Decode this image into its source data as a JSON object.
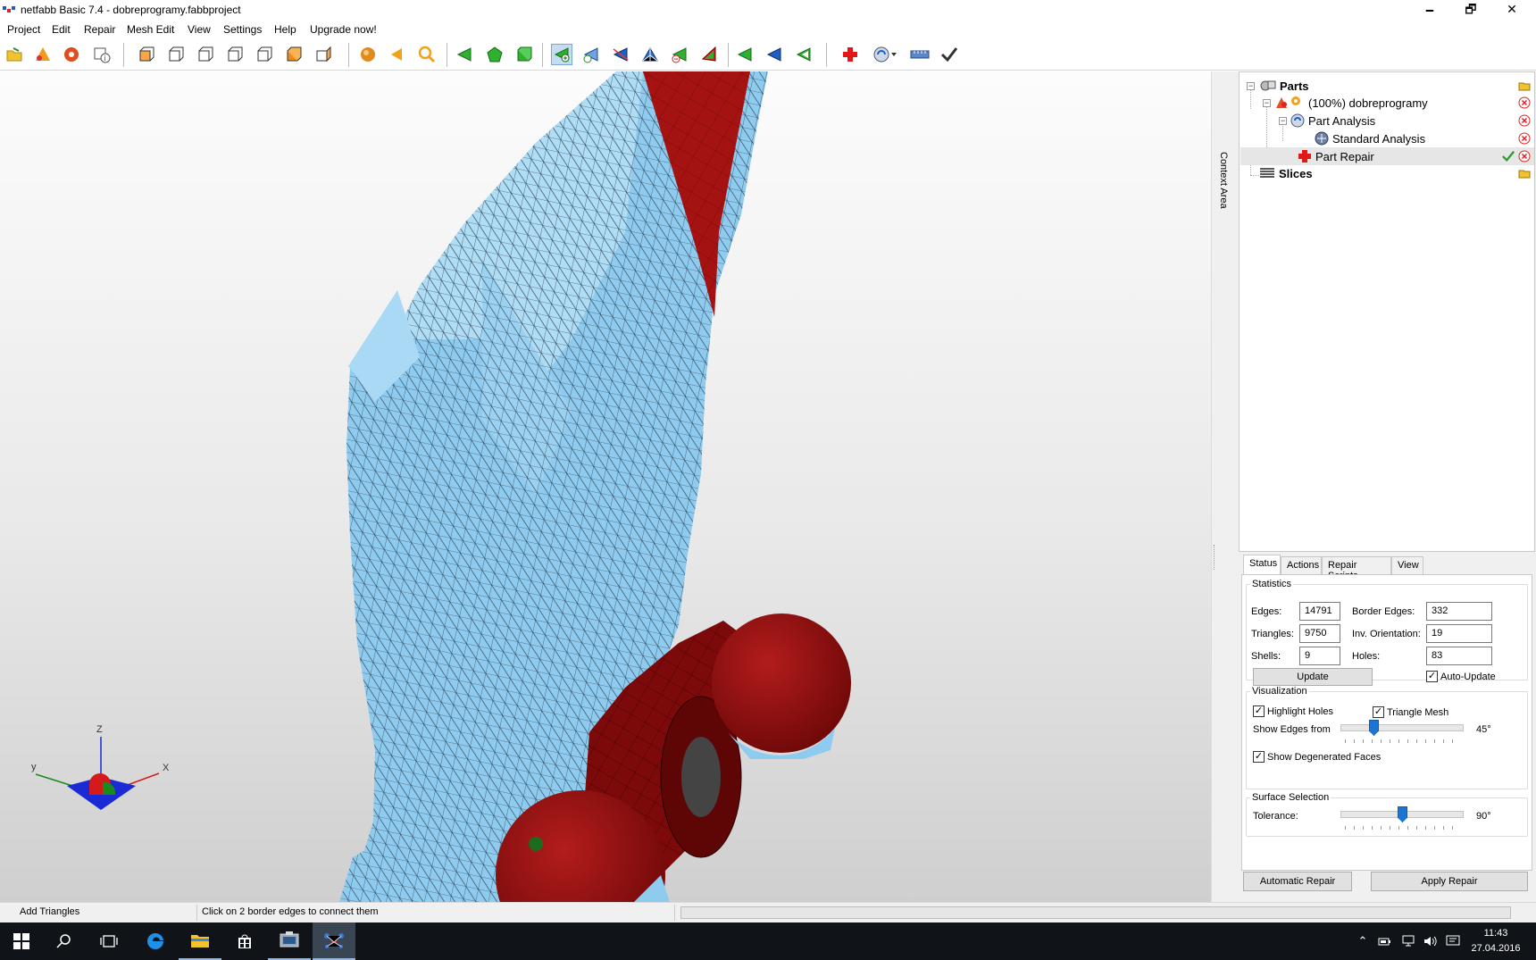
{
  "window": {
    "title": "netfabb Basic 7.4 - dobreprogramy.fabbproject",
    "minimize_glyph": "🗕",
    "restore_glyph": "🗗",
    "close_glyph": "✕"
  },
  "menu": [
    "Project",
    "Edit",
    "Repair",
    "Mesh Edit",
    "View",
    "Settings",
    "Help",
    "Upgrade now!"
  ],
  "toolbar": {
    "icons": [
      "open-project",
      "add-part",
      "remove-part",
      "part-info",
      "view-front",
      "view-back",
      "view-left",
      "view-right",
      "view-top",
      "view-bottom",
      "view-iso",
      "shaded-sphere",
      "select-arrow",
      "zoom-magnifier",
      "select-triangles",
      "select-surface",
      "select-shell",
      "add-triangles",
      "add-point",
      "split-triangles",
      "move-point",
      "remove-triangles",
      "remove-degenerated",
      "extend-selection",
      "invert-selection",
      "shrink-selection",
      "add-repair",
      "orientation-tool",
      "measure-ruler",
      "apply-check"
    ],
    "active": "add-triangles"
  },
  "context_area_label": "Context Area",
  "tree": {
    "items": [
      {
        "label": "Parts"
      },
      {
        "label": "(100%) dobreprogramy"
      },
      {
        "label": "Part Analysis"
      },
      {
        "label": "Standard Analysis"
      },
      {
        "label": "Part Repair"
      },
      {
        "label": "Slices"
      }
    ]
  },
  "tabs": [
    "Status",
    "Actions",
    "Repair Scripts",
    "View"
  ],
  "status": {
    "statistics_title": "Statistics",
    "edges_label": "Edges:",
    "edges": "14791",
    "triangles_label": "Triangles:",
    "triangles": "9750",
    "shells_label": "Shells:",
    "shells": "9",
    "border_edges_label": "Border Edges:",
    "border_edges": "332",
    "inv_orientation_label": "Inv. Orientation:",
    "inv_orientation": "19",
    "holes_label": "Holes:",
    "holes": "83",
    "update_button": "Update",
    "auto_update_label": "Auto-Update",
    "auto_update_checked": true
  },
  "visualization": {
    "title": "Visualization",
    "highlight_holes_label": "Highlight Holes",
    "highlight_holes_checked": true,
    "triangle_mesh_label": "Triangle Mesh",
    "triangle_mesh_checked": true,
    "show_edges_label": "Show Edges from",
    "show_edges_value": "45°",
    "show_edges_fraction": 0.25,
    "degenerated_label": "Show Degenerated Faces",
    "degenerated_checked": true
  },
  "surface_selection": {
    "title": "Surface Selection",
    "tolerance_label": "Tolerance:",
    "tolerance_value": "90°",
    "tolerance_fraction": 0.5
  },
  "buttons": {
    "automatic_repair": "Automatic Repair",
    "apply_repair": "Apply Repair"
  },
  "statusbar": {
    "tool": "Add Triangles",
    "hint": "Click on 2 border edges to connect them"
  },
  "axes": {
    "z": "Z",
    "y": "y",
    "x": "X"
  },
  "taskbar": {
    "icons": [
      "windows-start",
      "search",
      "task-view",
      "edge-browser",
      "file-explorer",
      "store",
      "network-app",
      "netfabb"
    ],
    "active": "netfabb",
    "clock_time": "11:43",
    "clock_date": "27.04.2016"
  },
  "colors": {
    "mesh_blue": "#8ecbef",
    "mesh_red": "#8b0d0d",
    "accent": "#1c75d3"
  }
}
